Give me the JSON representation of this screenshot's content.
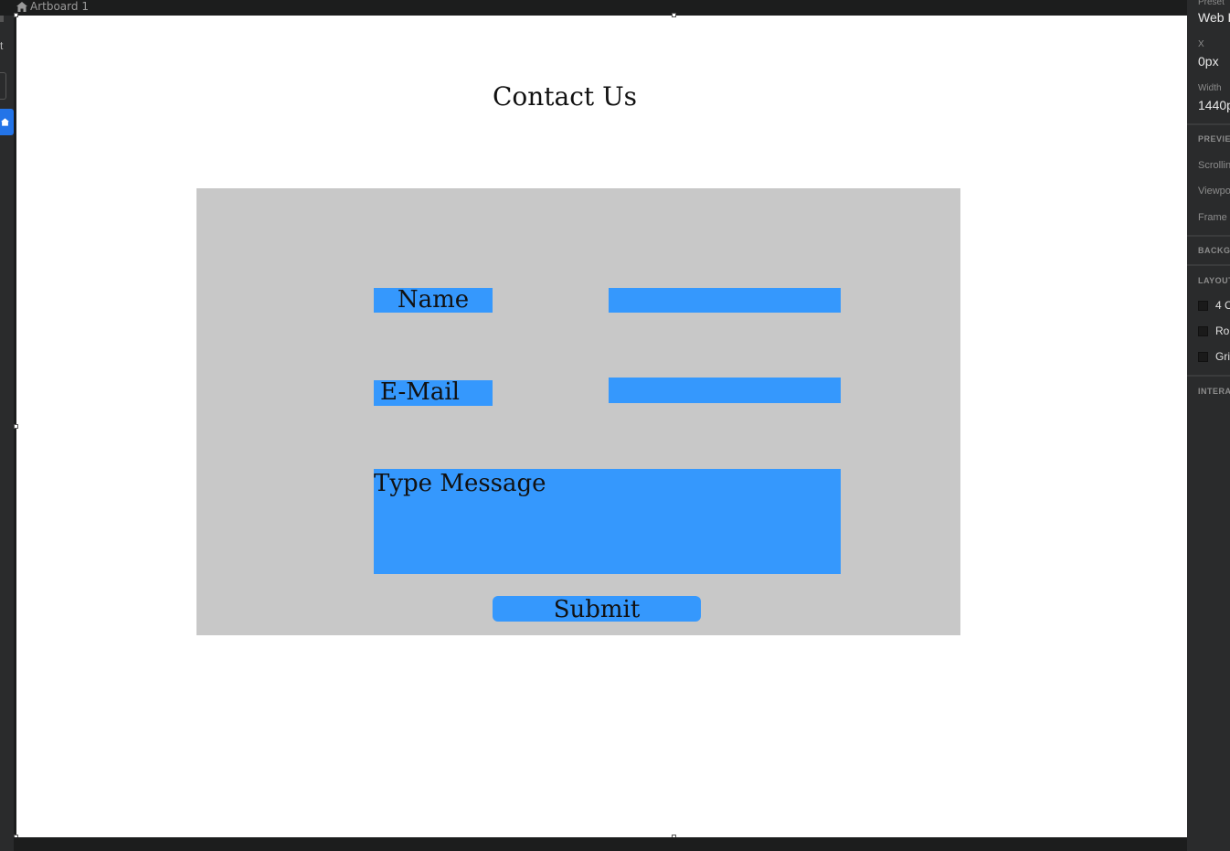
{
  "artboard": {
    "name": "Artboard 1"
  },
  "left_toolbar": {
    "partial_text": "t"
  },
  "page": {
    "title": "Contact Us",
    "form": {
      "name_label": "Name",
      "email_label": "E-Mail",
      "message_placeholder": "Type Message",
      "submit_label": "Submit"
    }
  },
  "inspector": {
    "preset_label": "Preset",
    "preset_value": "Web I",
    "x_label": "X",
    "x_value": "0px",
    "width_label": "Width",
    "width_value": "1440p",
    "preview_header": "PREVIE",
    "scrolling_label": "Scrollin",
    "viewport_label": "Viewpo",
    "frame_label": "Frame",
    "background_header": "BACKGI",
    "layout_header": "LAYOUT",
    "layout_options": [
      "4 C",
      "Ro",
      "Gri"
    ],
    "interactions_header": "INTERA"
  },
  "colors": {
    "accent": "#3598fd",
    "panel": "#c8c8c8",
    "selection": "#2374e8",
    "chrome": "#1c1d1d"
  }
}
